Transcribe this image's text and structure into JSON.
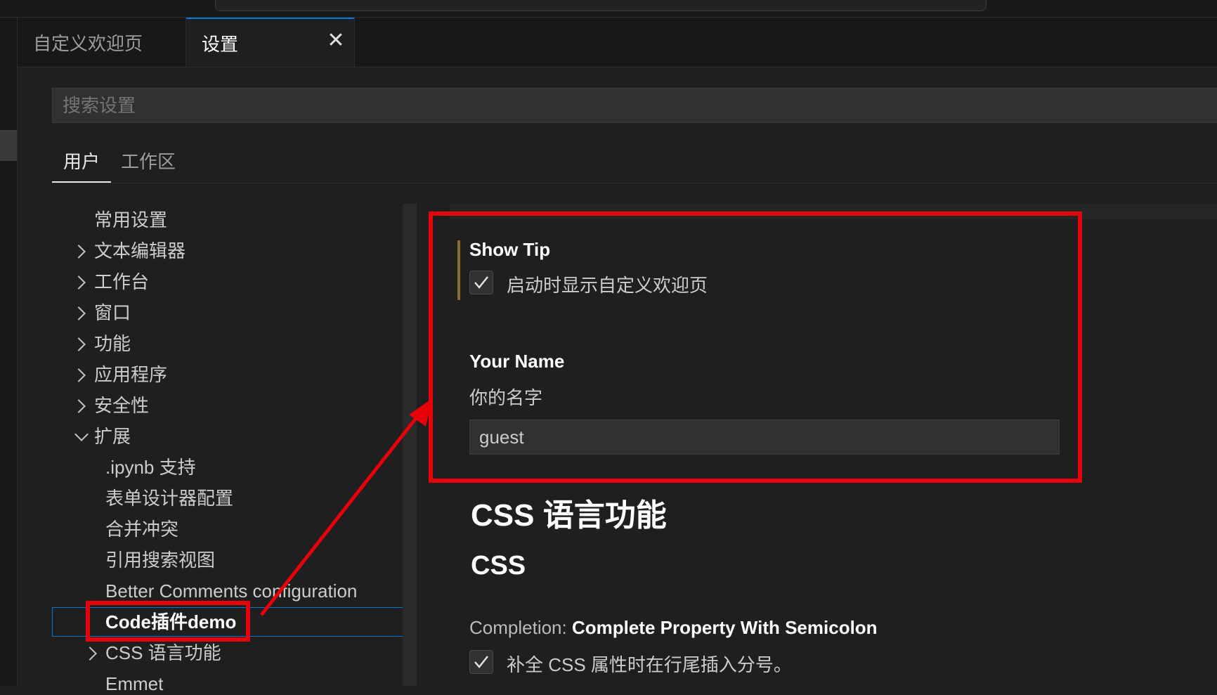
{
  "tabs": [
    {
      "label": "自定义欢迎页"
    },
    {
      "label": "设置"
    }
  ],
  "search": {
    "placeholder": "搜索设置"
  },
  "scope_tabs": {
    "user": "用户",
    "workspace": "工作区"
  },
  "toc": {
    "common": "常用设置",
    "text_editor": "文本编辑器",
    "workbench": "工作台",
    "window": "窗口",
    "features": "功能",
    "application": "应用程序",
    "security": "安全性",
    "extensions": "扩展",
    "ext_ipynb": ".ipynb 支持",
    "ext_form_designer": "表单设计器配置",
    "ext_merge_conflict": "合并冲突",
    "ext_reference_search": "引用搜索视图",
    "ext_better_comments": "Better Comments configuration",
    "ext_code_demo": "Code插件demo",
    "ext_css": "CSS 语言功能",
    "ext_emmet": "Emmet"
  },
  "settings": {
    "show_tip": {
      "title": "Show Tip",
      "description": "启动时显示自定义欢迎页",
      "checked": true
    },
    "your_name": {
      "title": "Your Name",
      "description": "你的名字",
      "value": "guest"
    },
    "css_section_title": "CSS 语言功能",
    "css_subsection_title": "CSS",
    "completion": {
      "category": "Completion:",
      "name": "Complete Property With Semicolon",
      "description": "补全 CSS 属性时在行尾插入分号。",
      "checked": true
    }
  },
  "colors": {
    "highlight": "#e8000b",
    "focus_border": "#0078d4",
    "modified_bar": "#8b6c2c"
  }
}
